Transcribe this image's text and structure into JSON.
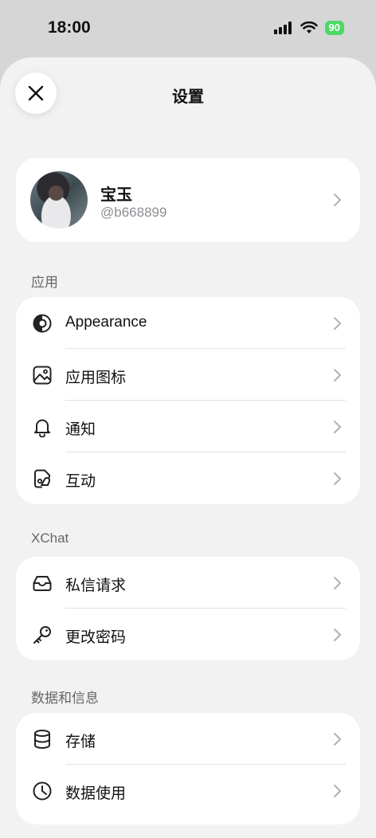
{
  "status_bar": {
    "time": "18:00",
    "battery": "90"
  },
  "header": {
    "title": "设置"
  },
  "profile": {
    "name": "宝玉",
    "handle": "@b668899"
  },
  "sections": [
    {
      "title": "应用",
      "items": [
        {
          "label": "Appearance",
          "icon": "appearance-icon"
        },
        {
          "label": "应用图标",
          "icon": "image-icon"
        },
        {
          "label": "通知",
          "icon": "bell-icon"
        },
        {
          "label": "互动",
          "icon": "interaction-icon"
        }
      ]
    },
    {
      "title": "XChat",
      "items": [
        {
          "label": "私信请求",
          "icon": "inbox-icon"
        },
        {
          "label": "更改密码",
          "icon": "key-icon"
        }
      ]
    },
    {
      "title": "数据和信息",
      "items": [
        {
          "label": "存储",
          "icon": "database-icon"
        },
        {
          "label": "数据使用",
          "icon": "clock-icon"
        }
      ]
    }
  ],
  "colors": {
    "accent_battery": "#4cd964",
    "sheet_bg": "#f2f2f2",
    "card_bg": "#ffffff"
  }
}
